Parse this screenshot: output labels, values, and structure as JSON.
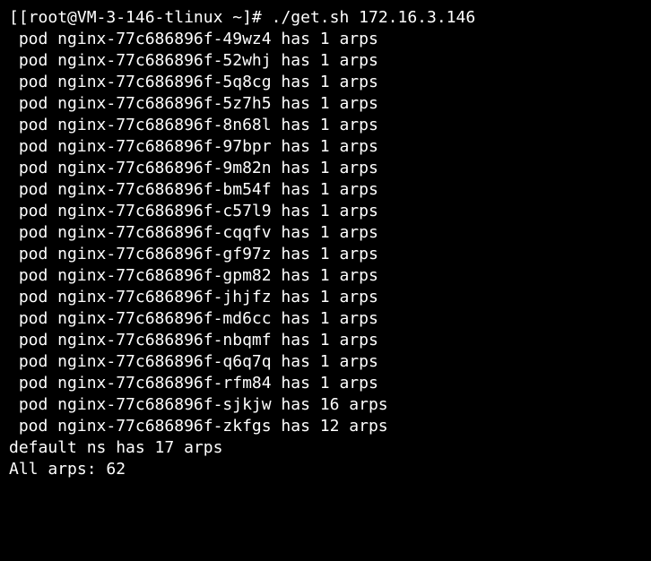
{
  "prompt": {
    "prefix": "[",
    "user_host": "[root@VM-3-146-tlinux ~]# ",
    "command": "./get.sh 172.16.3.146"
  },
  "pods": [
    {
      "name": "nginx-77c686896f-49wz4",
      "arps": 1
    },
    {
      "name": "nginx-77c686896f-52whj",
      "arps": 1
    },
    {
      "name": "nginx-77c686896f-5q8cg",
      "arps": 1
    },
    {
      "name": "nginx-77c686896f-5z7h5",
      "arps": 1
    },
    {
      "name": "nginx-77c686896f-8n68l",
      "arps": 1
    },
    {
      "name": "nginx-77c686896f-97bpr",
      "arps": 1
    },
    {
      "name": "nginx-77c686896f-9m82n",
      "arps": 1
    },
    {
      "name": "nginx-77c686896f-bm54f",
      "arps": 1
    },
    {
      "name": "nginx-77c686896f-c57l9",
      "arps": 1
    },
    {
      "name": "nginx-77c686896f-cqqfv",
      "arps": 1
    },
    {
      "name": "nginx-77c686896f-gf97z",
      "arps": 1
    },
    {
      "name": "nginx-77c686896f-gpm82",
      "arps": 1
    },
    {
      "name": "nginx-77c686896f-jhjfz",
      "arps": 1
    },
    {
      "name": "nginx-77c686896f-md6cc",
      "arps": 1
    },
    {
      "name": "nginx-77c686896f-nbqmf",
      "arps": 1
    },
    {
      "name": "nginx-77c686896f-q6q7q",
      "arps": 1
    },
    {
      "name": "nginx-77c686896f-rfm84",
      "arps": 1
    },
    {
      "name": "nginx-77c686896f-sjkjw",
      "arps": 16
    },
    {
      "name": "nginx-77c686896f-zkfgs",
      "arps": 12
    }
  ],
  "namespace_line": "default ns has 17 arps",
  "total_line": "All arps: 62"
}
